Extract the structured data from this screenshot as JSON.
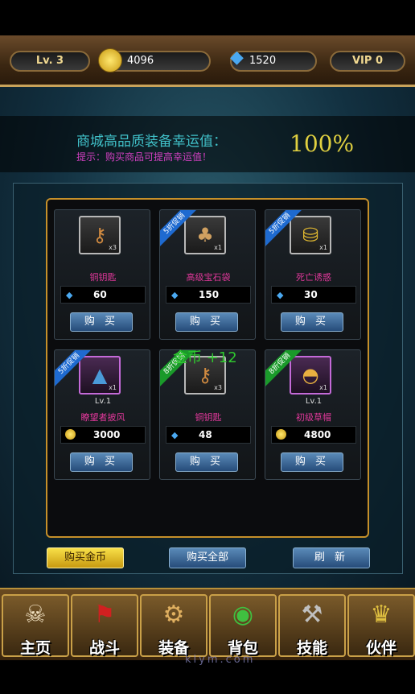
{
  "hud": {
    "level": "Lv. 3",
    "gold": "4096",
    "gems": "1520",
    "vip": "VIP 0"
  },
  "luck": {
    "title": "商城高品质装备幸运值：",
    "hint": "提示：购买商品可提高幸运值！",
    "value": "100%"
  },
  "items": [
    {
      "name": "铜钥匙",
      "price": "60",
      "currency": "gem",
      "qty": "x3",
      "level": "",
      "badge": "",
      "badge_color": "",
      "icon": "key-icon",
      "purple": false
    },
    {
      "name": "高级宝石袋",
      "price": "150",
      "currency": "gem",
      "qty": "x1",
      "level": "",
      "badge": "5折促销",
      "badge_color": "blue",
      "icon": "gem-bag-icon",
      "purple": false
    },
    {
      "name": "死亡诱惑",
      "price": "30",
      "currency": "gem",
      "qty": "x1",
      "level": "",
      "badge": "5折促销",
      "badge_color": "blue",
      "icon": "treasure-icon",
      "purple": false
    },
    {
      "name": "瞭望者披风",
      "price": "3000",
      "currency": "gold",
      "qty": "x1",
      "level": "Lv.1",
      "badge": "5折促销",
      "badge_color": "blue",
      "icon": "cloak-icon",
      "purple": true
    },
    {
      "name": "铜钥匙",
      "price": "48",
      "currency": "gem",
      "qty": "x3",
      "level": "",
      "badge": "8折促销",
      "badge_color": "green",
      "icon": "key-icon",
      "purple": false
    },
    {
      "name": "初级草帽",
      "price": "4800",
      "currency": "gold",
      "qty": "x1",
      "level": "Lv.1",
      "badge": "8折促销",
      "badge_color": "green",
      "icon": "straw-hat-icon",
      "purple": true
    }
  ],
  "buy_label": "购  买",
  "floating_text": "金币 +12",
  "actions": {
    "buy_gold": "购买金币",
    "buy_all": "购买全部",
    "refresh": "刷  新"
  },
  "nav": [
    {
      "label": "主页",
      "icon": "skull-hat-icon"
    },
    {
      "label": "战斗",
      "icon": "pirate-flag-icon"
    },
    {
      "label": "装备",
      "icon": "equipment-icon"
    },
    {
      "label": "背包",
      "icon": "bag-icon"
    },
    {
      "label": "技能",
      "icon": "hammer-icon"
    },
    {
      "label": "伙伴",
      "icon": "partner-icon"
    }
  ],
  "watermark": "klym.com",
  "colors": {
    "accent_gold": "#c6902a",
    "item_name": "#e0389a",
    "luck_title": "#40c0c8",
    "luck_hint": "#d040c0",
    "luck_value": "#e0d040"
  }
}
